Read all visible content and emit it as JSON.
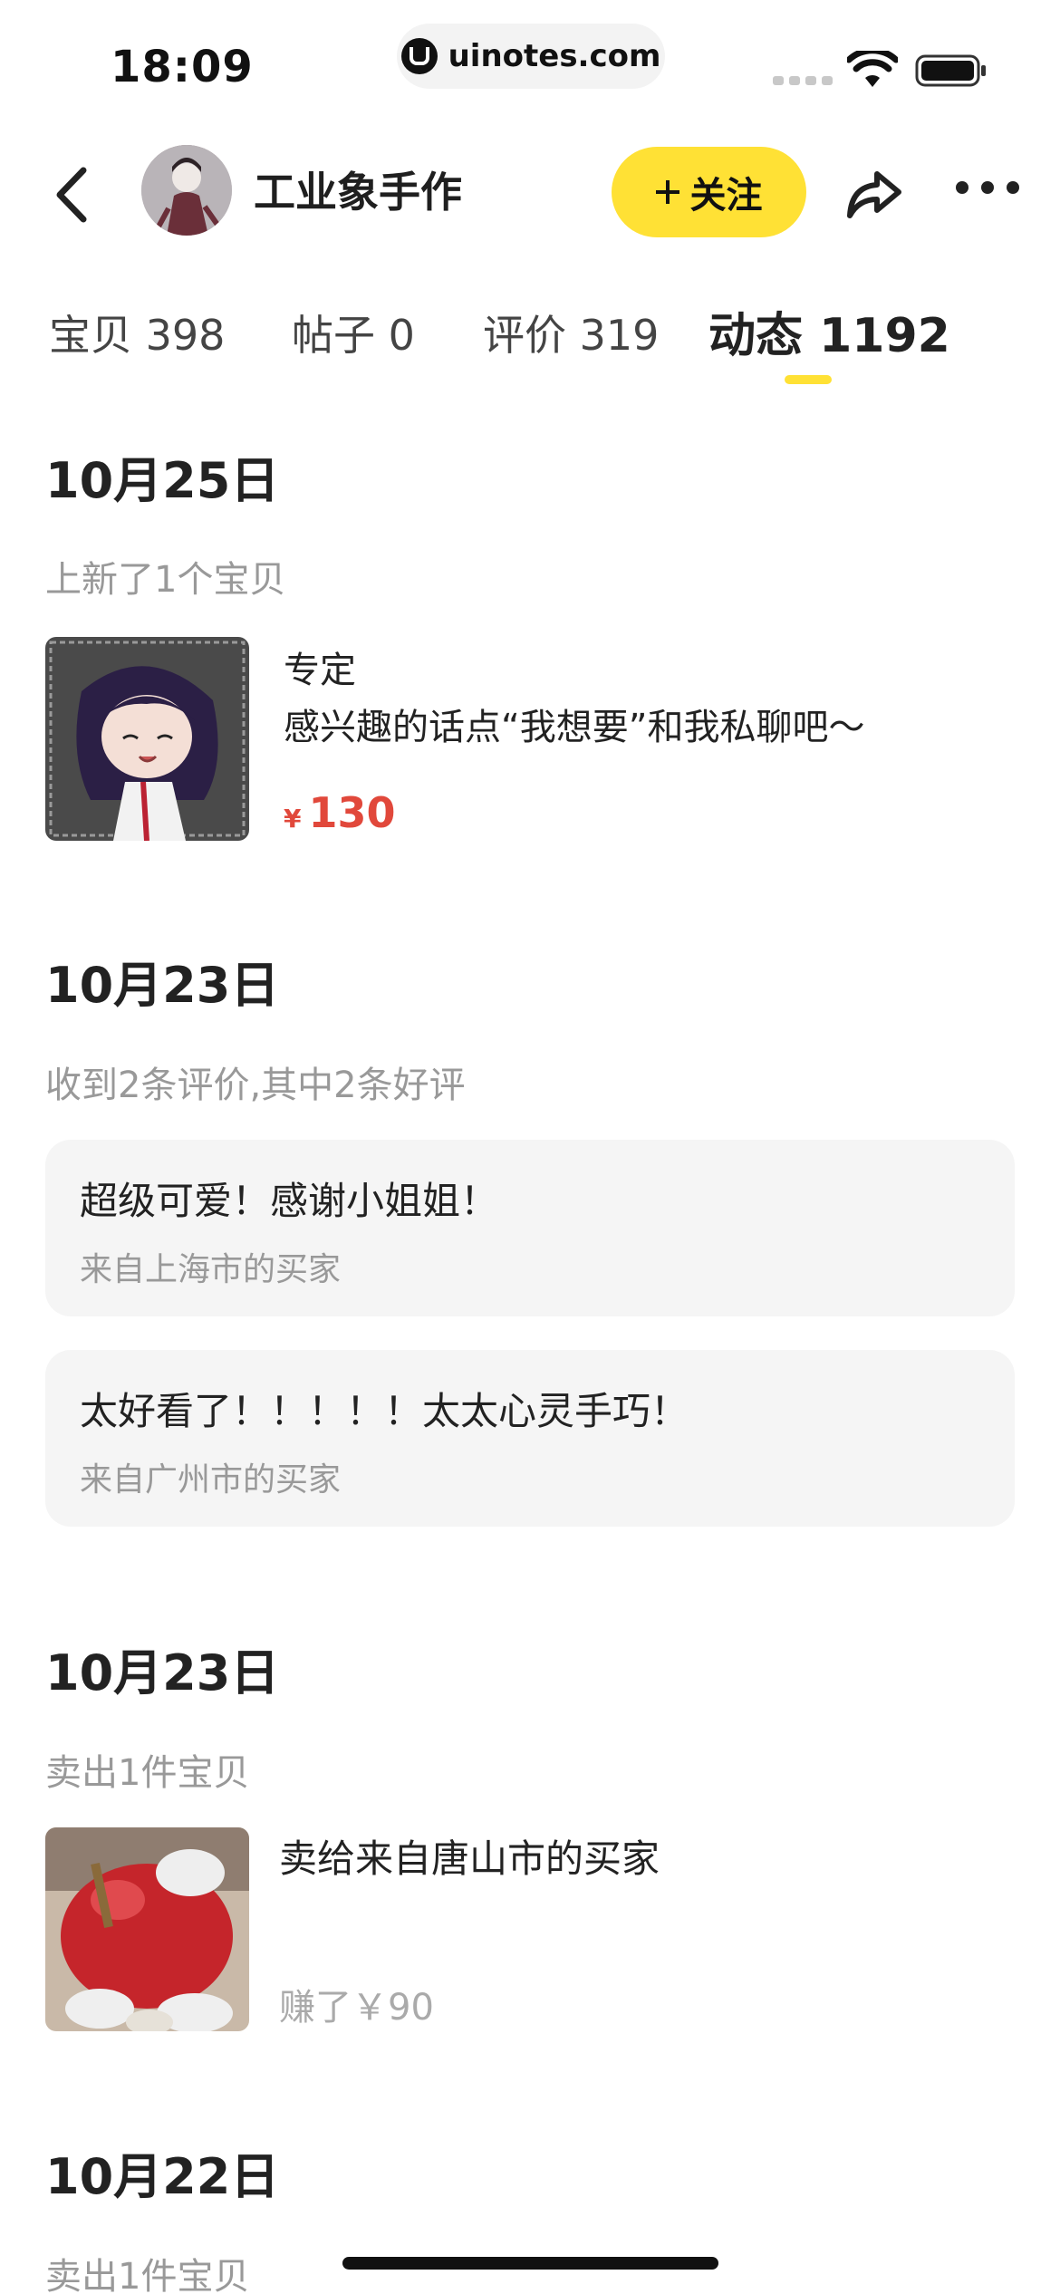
{
  "status_bar": {
    "time": "18:09",
    "url": "uinotes.com"
  },
  "header": {
    "shop_name": "工业象手作",
    "follow_label": "关注"
  },
  "tabs": [
    {
      "label": "宝贝 398",
      "active": false
    },
    {
      "label": "帖子 0",
      "active": false
    },
    {
      "label": "评价 319",
      "active": false
    },
    {
      "label": "动态 1192",
      "active": true
    }
  ],
  "feed": {
    "group1": {
      "date": "10月25日",
      "event": "上新了1个宝贝",
      "item": {
        "title": "专定",
        "desc": "感兴趣的话点“我想要”和我私聊吧～",
        "currency": "¥",
        "price": "130"
      }
    },
    "group2": {
      "date": "10月23日",
      "event": "收到2条评价,其中2条好评",
      "reviews": [
        {
          "text": "超级可爱！感谢小姐姐！",
          "from": "来自上海市的买家"
        },
        {
          "text": "太好看了！！！！！太太心灵手巧！",
          "from": "来自广州市的买家"
        }
      ]
    },
    "group3": {
      "date": "10月23日",
      "event": "卖出1件宝贝",
      "sold": {
        "title": "卖给来自唐山市的买家",
        "earned": "赚了￥90"
      }
    },
    "group4": {
      "date": "10月22日",
      "event": "卖出1件宝贝"
    }
  },
  "colors": {
    "accent": "#ffe135",
    "price": "#e1483b"
  }
}
